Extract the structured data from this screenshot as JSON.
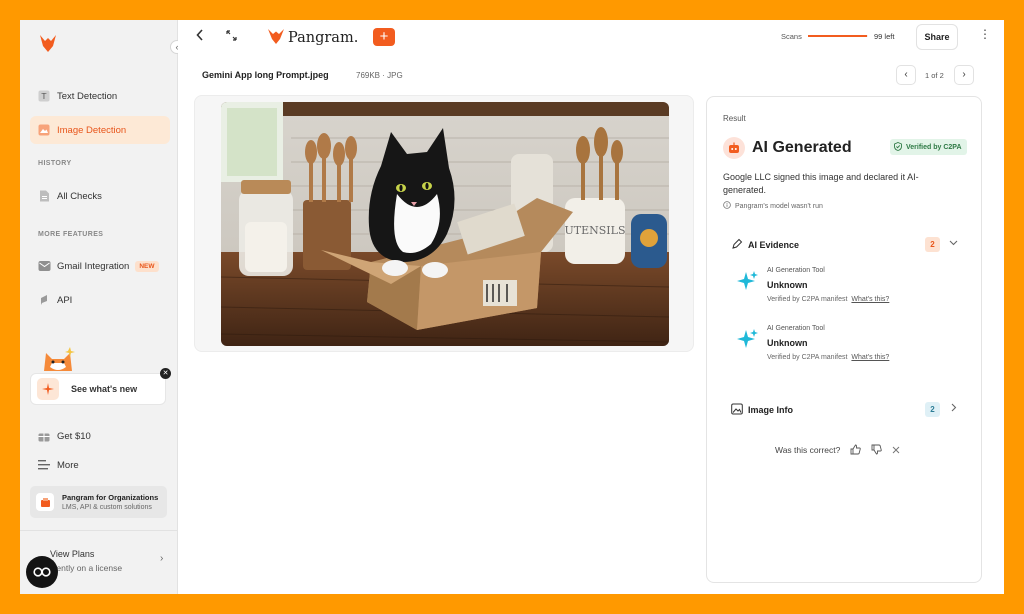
{
  "sidebar": {
    "nav": [
      {
        "label": "Text Detection"
      },
      {
        "label": "Image Detection"
      }
    ],
    "history_label": "HISTORY",
    "all_checks": "All Checks",
    "more_features_label": "MORE FEATURES",
    "gmail": "Gmail Integration",
    "gmail_badge": "NEW",
    "api": "API",
    "whats_new": "See what's new",
    "get10": "Get $10",
    "more": "More",
    "org_title": "Pangram for Organizations",
    "org_sub": "LMS, API & custom solutions",
    "view_plans": "View Plans",
    "license": "urrently on a license"
  },
  "topbar": {
    "brand": "Pangram.",
    "scans_label": "Scans",
    "scans_left": "99 left",
    "scans_remaining_fraction": 0.99,
    "share": "Share"
  },
  "file": {
    "name": "Gemini App long Prompt.jpeg",
    "meta": "769KB · JPG",
    "pager": "1 of 2"
  },
  "result": {
    "label": "Result",
    "title": "AI Generated",
    "c2pa_badge": "Verified by C2PA",
    "description": "Google LLC signed this image and declared it AI-generated.",
    "note": "Pangram's model wasn't run",
    "evidence_title": "AI Evidence",
    "evidence_count": "2",
    "evidence": [
      {
        "label": "AI Generation Tool",
        "value": "Unknown",
        "meta": "Verified by C2PA manifest",
        "link": "What's this?"
      },
      {
        "label": "AI Generation Tool",
        "value": "Unknown",
        "meta": "Verified by C2PA manifest",
        "link": "What's this?"
      }
    ],
    "image_info_title": "Image Info",
    "image_info_count": "2",
    "feedback": "Was this correct?"
  },
  "colors": {
    "accent": "#f25c1f",
    "background": "#ff9900",
    "sparkle": "#1fb8d8"
  }
}
